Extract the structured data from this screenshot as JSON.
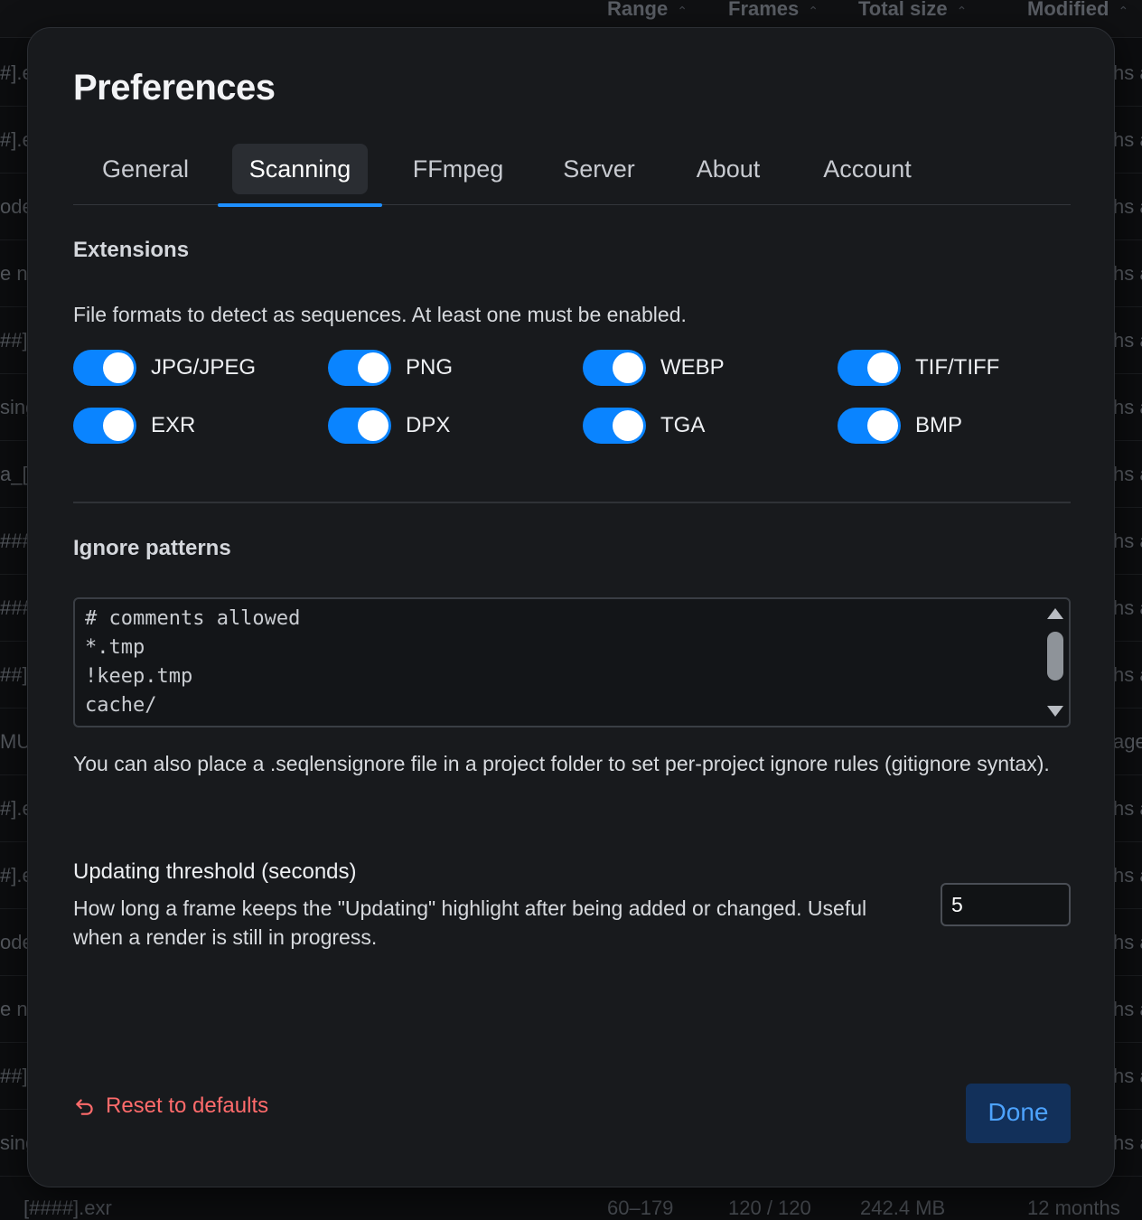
{
  "background": {
    "columns": [
      "Range",
      "Frames",
      "Total size",
      "Modified"
    ],
    "rows_left": [
      "#].e",
      "#].e",
      "ode",
      "e n",
      "##].",
      "sing",
      "a_[",
      "###",
      "###",
      "##].",
      "MU",
      "#].e",
      "#].e",
      "ode",
      "e n",
      "##].",
      "sing"
    ],
    "rows_right": [
      "hs a",
      "hs a",
      "hs a",
      "hs a",
      "hs a",
      "hs a",
      "hs a",
      "hs a",
      "hs a",
      "hs a",
      "age",
      "hs a",
      "hs a",
      "hs a",
      "hs a",
      "hs a",
      "hs a"
    ],
    "bottom_row": {
      "name": "[####].exr",
      "range": "60–179",
      "frames": "120 / 120",
      "size": "242.4 MB",
      "modified": "12 months"
    }
  },
  "modal": {
    "title": "Preferences",
    "tabs": [
      "General",
      "Scanning",
      "FFmpeg",
      "Server",
      "About",
      "Account"
    ],
    "active_tab": "Scanning",
    "extensions": {
      "title": "Extensions",
      "description": "File formats to detect as sequences. At least one must be enabled.",
      "toggles": [
        {
          "label": "JPG/JPEG",
          "enabled": true
        },
        {
          "label": "PNG",
          "enabled": true
        },
        {
          "label": "WEBP",
          "enabled": true
        },
        {
          "label": "TIF/TIFF",
          "enabled": true
        },
        {
          "label": "EXR",
          "enabled": true
        },
        {
          "label": "DPX",
          "enabled": true
        },
        {
          "label": "TGA",
          "enabled": true
        },
        {
          "label": "BMP",
          "enabled": true
        }
      ]
    },
    "ignore": {
      "title": "Ignore patterns",
      "lines": [
        "# comments allowed",
        "*.tmp",
        "!keep.tmp",
        "cache/"
      ],
      "note": "You can also place a .seqlensignore file in a project folder to set per-project ignore rules (gitignore syntax)."
    },
    "threshold": {
      "title": "Updating threshold (seconds)",
      "description": "How long a frame keeps the \"Updating\" highlight after being added or changed. Useful when a render is still in progress.",
      "value": "5"
    },
    "reset_label": "Reset to defaults",
    "done_label": "Done",
    "colors": {
      "accent": "#0a84ff",
      "reset": "#ff6b6b",
      "done_bg": "#12305a"
    }
  }
}
